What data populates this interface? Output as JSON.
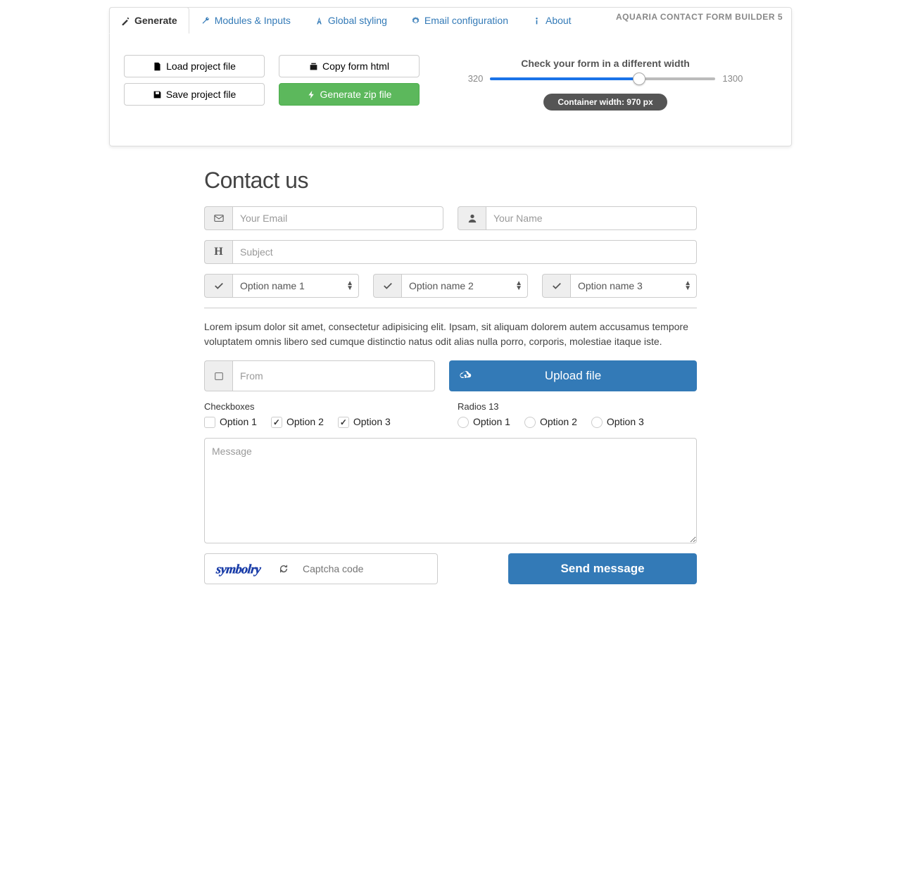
{
  "brand": "AQUARIA CONTACT FORM BUILDER 5",
  "tabs": {
    "generate": "Generate",
    "modules": "Modules & Inputs",
    "styling": "Global styling",
    "email": "Email configuration",
    "about": "About"
  },
  "toolbar": {
    "load": "Load project file",
    "save": "Save project file",
    "copy": "Copy form html",
    "zip": "Generate zip file"
  },
  "slider": {
    "title": "Check your form in a different width",
    "min": "320",
    "max": "1300",
    "badge": "Container width: 970 px"
  },
  "form": {
    "heading": "Contact us",
    "email_ph": "Your Email",
    "name_ph": "Your Name",
    "subject_ph": "Subject",
    "opt1": "Option name 1",
    "opt2": "Option name 2",
    "opt3": "Option name 3",
    "lorem": "Lorem ipsum dolor sit amet, consectetur adipisicing elit. Ipsam, sit aliquam dolorem autem accusamus tempore voluptatem omnis libero sed cumque distinctio natus odit alias nulla porro, corporis, molestiae itaque iste.",
    "from_ph": "From",
    "upload": "Upload file",
    "checkboxes_label": "Checkboxes",
    "radios_label": "Radios 13",
    "o1": "Option 1",
    "o2": "Option 2",
    "o3": "Option 3",
    "message_ph": "Message",
    "captcha_text": "symbolry",
    "captcha_ph": "Captcha code",
    "send": "Send message"
  }
}
